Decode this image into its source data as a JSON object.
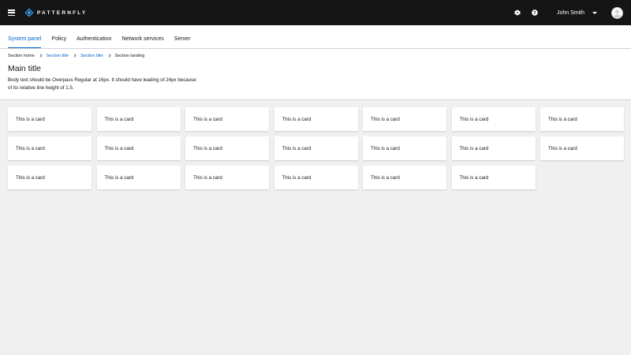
{
  "masthead": {
    "brand": "PATTERNFLY",
    "user_name": "John Smith",
    "icons": [
      "hamburger-icon",
      "gear-icon",
      "help-icon",
      "caret-down-icon",
      "avatar"
    ]
  },
  "nav": {
    "items": [
      {
        "label": "System panel",
        "active": true
      },
      {
        "label": "Policy"
      },
      {
        "label": "Authentication"
      },
      {
        "label": "Network services"
      },
      {
        "label": "Server"
      }
    ]
  },
  "breadcrumb": {
    "items": [
      {
        "label": "Section home"
      },
      {
        "label": "Section title"
      },
      {
        "label": "Section title"
      },
      {
        "label": "Section landing"
      }
    ]
  },
  "header": {
    "title": "Main title",
    "body_line1": "Body text should be Overpass Regular at 16px. It should have leading of 24px because",
    "body_line2": "of its relative line height of 1.5."
  },
  "cards": [
    "This is a card",
    "This is a card",
    "This is a card",
    "This is a card",
    "This is a card",
    "This is a card",
    "This is a card",
    "This is a card",
    "This is a card",
    "This is a card",
    "This is a card",
    "This is a card",
    "This is a card",
    "This is a card",
    "This is a card",
    "This is a card",
    "This is a card",
    "This is a card",
    "This is a card",
    "This is a card"
  ],
  "colors": {
    "masthead_bg": "#151515",
    "link": "#0066cc",
    "page_bg": "#f0f0f0"
  }
}
